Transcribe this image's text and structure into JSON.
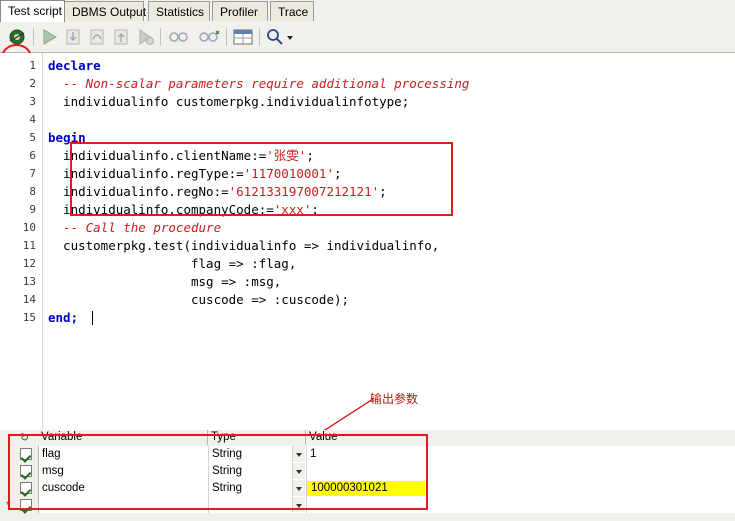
{
  "window": {
    "tabs": [
      {
        "label": "Test script",
        "active": true
      },
      {
        "label": "DBMS Output",
        "active": false
      },
      {
        "label": "Statistics",
        "active": false
      },
      {
        "label": "Profiler",
        "active": false
      },
      {
        "label": "Trace",
        "active": false
      }
    ]
  },
  "toolbar": {
    "items": [
      {
        "name": "execute-button",
        "title": "Execute"
      },
      {
        "name": "run-button",
        "title": "Run"
      },
      {
        "name": "step-into-button",
        "title": "Step Into"
      },
      {
        "name": "step-over-button",
        "title": "Step Over"
      },
      {
        "name": "step-out-button",
        "title": "Step Out"
      },
      {
        "name": "run-to-exception-button",
        "title": "Run to Exception"
      },
      {
        "name": "breakpoints-button",
        "title": "Breakpoints"
      },
      {
        "name": "call-stack-button",
        "title": "Call Stack"
      },
      {
        "name": "variables-button",
        "title": "Variables"
      },
      {
        "name": "find-button",
        "title": "Find"
      },
      {
        "name": "find-dropdown",
        "title": "Find options"
      }
    ]
  },
  "editor": {
    "line_numbers": [
      "1",
      "2",
      "3",
      "4",
      "5",
      "6",
      "7",
      "8",
      "9",
      "10",
      "11",
      "12",
      "13",
      "14",
      "15"
    ],
    "lines": [
      [
        {
          "t": "declare",
          "c": "kw"
        }
      ],
      [
        {
          "t": "  -- Non-scalar parameters require additional processing",
          "c": "cmt"
        }
      ],
      [
        {
          "t": "  individualinfo customerpkg.individualinfotype;",
          "c": "plain"
        }
      ],
      [
        {
          "t": "",
          "c": "plain"
        }
      ],
      [
        {
          "t": "begin",
          "c": "kw"
        }
      ],
      [
        {
          "t": "  individualinfo.clientName:=",
          "c": "plain"
        },
        {
          "t": "'张雯'",
          "c": "str"
        },
        {
          "t": ";",
          "c": "plain"
        }
      ],
      [
        {
          "t": "  individualinfo.regType:=",
          "c": "plain"
        },
        {
          "t": "'1170010001'",
          "c": "str"
        },
        {
          "t": ";",
          "c": "plain"
        }
      ],
      [
        {
          "t": "  individualinfo.regNo:=",
          "c": "plain"
        },
        {
          "t": "'612133197007212121'",
          "c": "str"
        },
        {
          "t": ";",
          "c": "plain"
        }
      ],
      [
        {
          "t": "  individualinfo.companyCode:=",
          "c": "plain"
        },
        {
          "t": "'xxx'",
          "c": "str"
        },
        {
          "t": ";",
          "c": "plain"
        }
      ],
      [
        {
          "t": "  -- Call the procedure",
          "c": "cmt"
        }
      ],
      [
        {
          "t": "  customerpkg.test(individualinfo => individualinfo,",
          "c": "plain"
        }
      ],
      [
        {
          "t": "                   flag => :flag,",
          "c": "plain"
        }
      ],
      [
        {
          "t": "                   msg => :msg,",
          "c": "plain"
        }
      ],
      [
        {
          "t": "                   cuscode => :cuscode);",
          "c": "plain"
        }
      ],
      [
        {
          "t": "end;",
          "c": "kw"
        }
      ]
    ],
    "annotation": "输出参数"
  },
  "variables_grid": {
    "columns": [
      "Variable",
      "Type",
      "Value"
    ],
    "rows": [
      {
        "checked": true,
        "variable": "flag",
        "type": "String",
        "value": "1",
        "highlight": false
      },
      {
        "checked": true,
        "variable": "msg",
        "type": "String",
        "value": "",
        "highlight": false
      },
      {
        "checked": true,
        "variable": "cuscode",
        "type": "String",
        "value": "100000301021",
        "highlight": true
      },
      {
        "checked": true,
        "variable": "",
        "type": "",
        "value": "",
        "highlight": false
      }
    ],
    "new_row_marker": "*"
  },
  "colors": {
    "highlight_red": "#e01b1b",
    "value_highlight": "#ffff00",
    "keyword": "#0000c0",
    "string": "#d01c1c",
    "comment": "#d01c1c"
  }
}
